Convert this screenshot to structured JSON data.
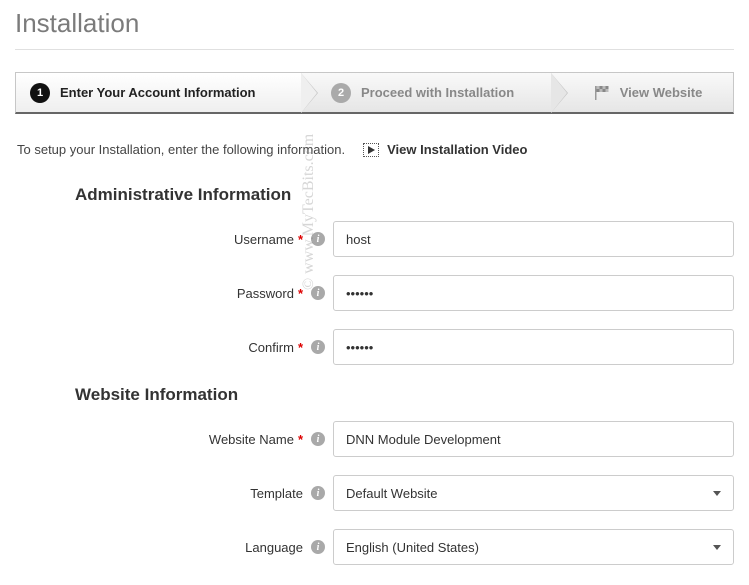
{
  "page_title": "Installation",
  "steps": {
    "s1": {
      "num": "1",
      "label": "Enter Your Account Information"
    },
    "s2": {
      "num": "2",
      "label": "Proceed with Installation"
    },
    "s3": {
      "label": "View Website"
    }
  },
  "intro": {
    "text": "To setup your Installation, enter the following information.",
    "video_label": "View Installation Video"
  },
  "admin_section": {
    "title": "Administrative Information",
    "username": {
      "label": "Username",
      "value": "host"
    },
    "password": {
      "label": "Password",
      "value": "••••••"
    },
    "confirm": {
      "label": "Confirm",
      "value": "••••••"
    }
  },
  "website_section": {
    "title": "Website Information",
    "name": {
      "label": "Website Name",
      "value": "DNN Module Development"
    },
    "template": {
      "label": "Template",
      "value": "Default Website"
    },
    "language": {
      "label": "Language",
      "value": "English (United States)"
    }
  },
  "watermark": "© www.MyTecBits.com"
}
